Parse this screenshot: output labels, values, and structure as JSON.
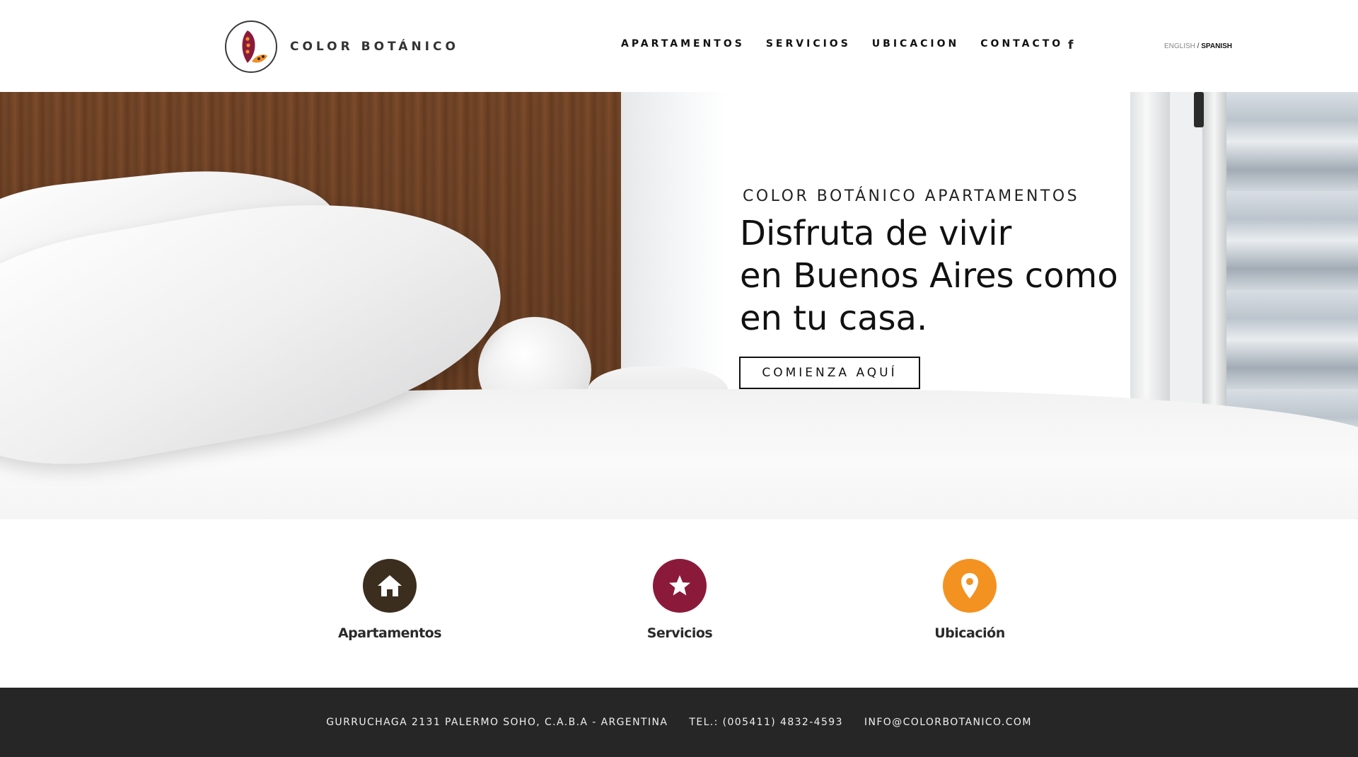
{
  "brand": {
    "name": "COLOR BOTÁNICO",
    "logo_colors": [
      "#8b1a3a",
      "#f0902a",
      "#3a2a1a"
    ]
  },
  "nav": {
    "items": [
      {
        "label": "APARTAMENTOS"
      },
      {
        "label": "SERVICIOS"
      },
      {
        "label": "UBICACION"
      },
      {
        "label": "CONTACTO"
      }
    ],
    "facebook_icon": "f",
    "lang_english": "ENGLISH",
    "lang_sep": " / ",
    "lang_spanish": "SPANISH"
  },
  "hero": {
    "subtitle": "COLOR BOTÁNICO APARTAMENTOS",
    "title_lines": [
      "Disfruta de vivir",
      "en Buenos Aires como",
      "en tu casa."
    ],
    "cta_label": "COMIENZA AQUÍ"
  },
  "features": [
    {
      "label": "Apartamentos",
      "icon": "home-icon",
      "color": "#3b2e1f"
    },
    {
      "label": "Servicios",
      "icon": "star-icon",
      "color": "#8b1a3a"
    },
    {
      "label": "Ubicación",
      "icon": "location-pin-icon",
      "color": "#f39221"
    }
  ],
  "footer": {
    "address": "GURRUCHAGA 2131  PALERMO SOHO, C.A.B.A  - ARGENTINA",
    "phone": "TEL.: (005411) 4832-4593",
    "email": "INFO@COLORBOTANICO.COM"
  }
}
